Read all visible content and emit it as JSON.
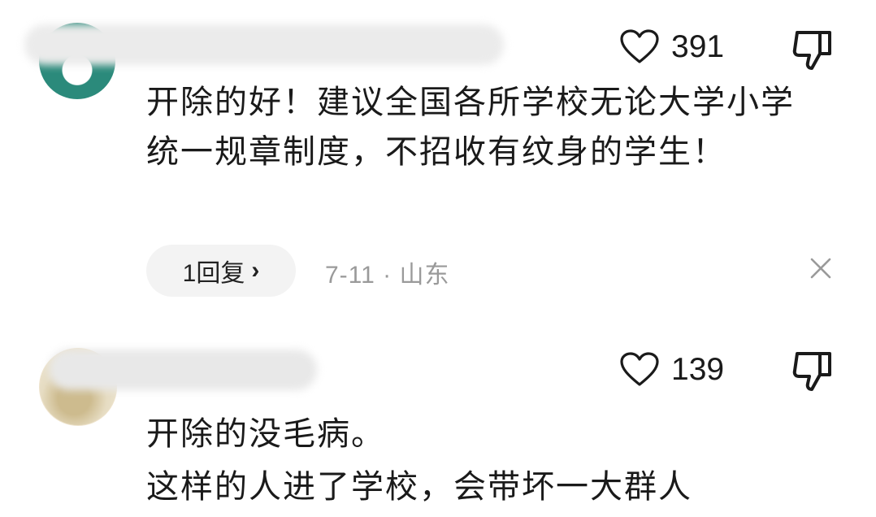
{
  "comments": [
    {
      "text": "开除的好！建议全国各所学校无论大学小学统一规章制度，不招收有纹身的学生！",
      "likes": "391",
      "replies_label": "1回复",
      "reply_chevron": "›",
      "date": "7-11",
      "separator": "·",
      "location": "山东"
    },
    {
      "text": "开除的没毛病。\n这样的人进了学校，会带坏一大群人",
      "likes": "139"
    }
  ],
  "icons": {
    "like": "heart-outline-icon",
    "dislike": "thumbs-down-icon",
    "close": "close-icon",
    "reply": "chevron-right-icon"
  },
  "colors": {
    "text": "#1a1a1a",
    "meta": "#9a9a9a",
    "pill": "#f3f3f3",
    "avatar1": "#2b8a7b"
  }
}
